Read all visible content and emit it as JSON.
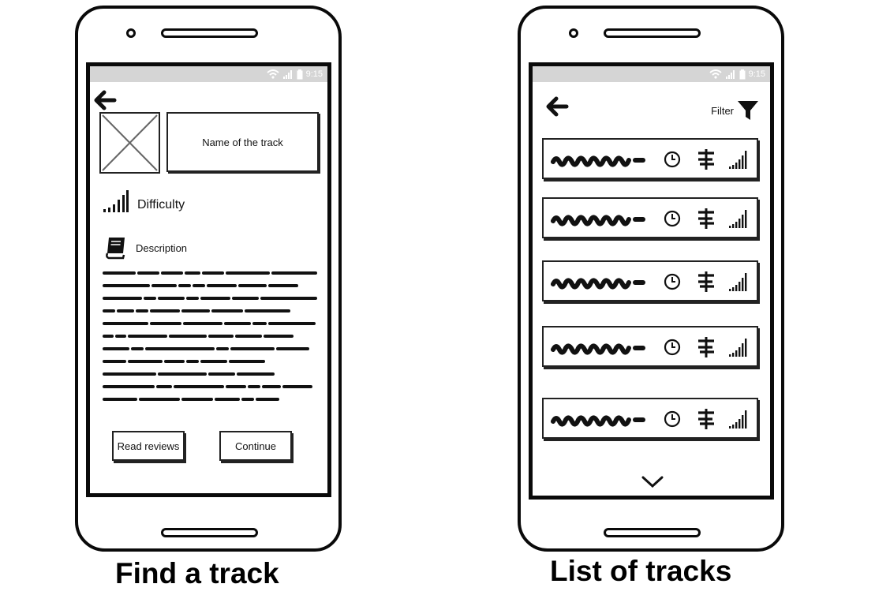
{
  "status_bar": {
    "time": "9:15"
  },
  "find_track": {
    "caption": "Find a track",
    "name_box": "Name of the track",
    "difficulty_label": "Difficulty",
    "description_label": "Description",
    "read_reviews_button": "Read reviews",
    "continue_button": "Continue"
  },
  "list_tracks": {
    "caption": "List of tracks",
    "filter_label": "Filter",
    "track_count": 5
  },
  "icons": {
    "back": "arrow-left-icon",
    "image": "image-placeholder-icon",
    "difficulty": "signal-bars-icon",
    "description": "book-icon",
    "filter": "funnel-icon",
    "duration": "clock-icon",
    "distance": "signpost-icon",
    "more": "chevron-down-icon"
  }
}
